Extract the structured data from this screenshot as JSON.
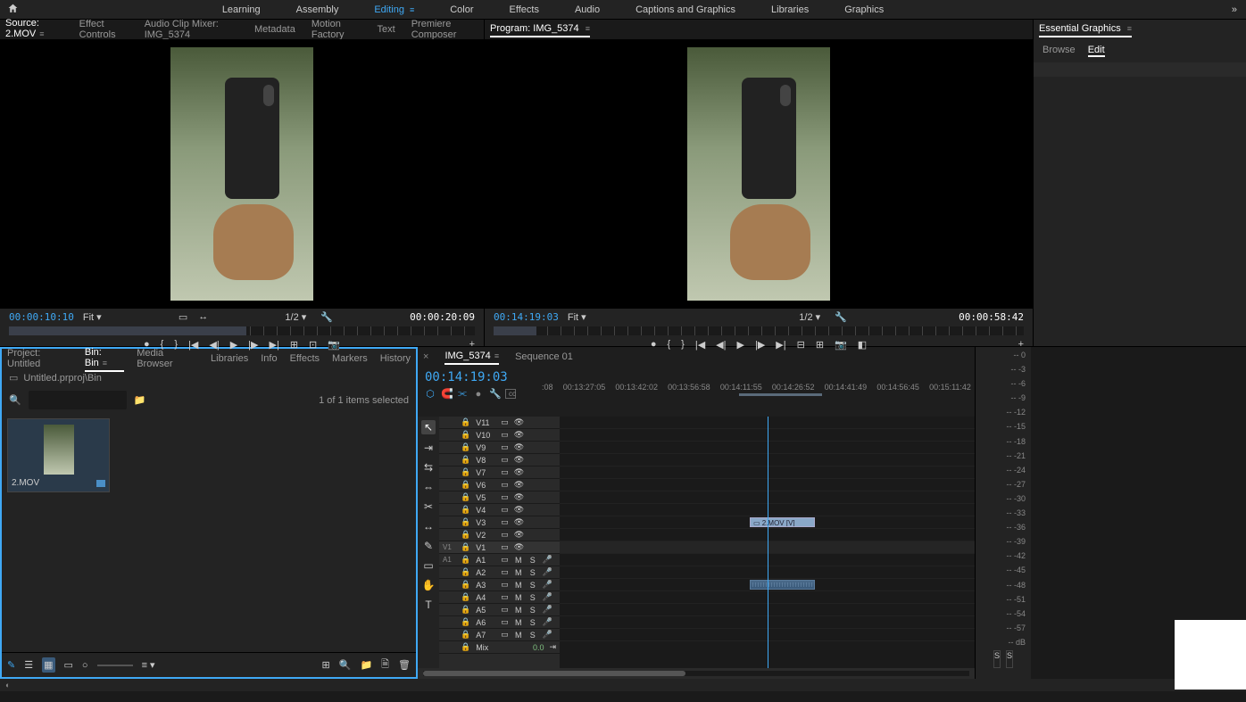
{
  "workspaces": {
    "items": [
      "Learning",
      "Assembly",
      "Editing",
      "Color",
      "Effects",
      "Audio",
      "Captions and Graphics",
      "Libraries",
      "Graphics"
    ],
    "active": "Editing"
  },
  "source": {
    "tabs": [
      "Source: 2.MOV",
      "Effect Controls",
      "Audio Clip Mixer: IMG_5374",
      "Metadata",
      "Motion Factory",
      "Text",
      "Premiere Composer"
    ],
    "active": "Source: 2.MOV",
    "timecode_in": "00:00:10:10",
    "timecode_dur": "00:00:20:09",
    "fit": "Fit",
    "zoom": "1/2"
  },
  "program": {
    "title": "Program: IMG_5374",
    "timecode": "00:14:19:03",
    "duration": "00:00:58:42",
    "fit": "Fit",
    "zoom": "1/2"
  },
  "essential": {
    "title": "Essential Graphics",
    "tabs": [
      "Browse",
      "Edit"
    ],
    "active": "Edit"
  },
  "project": {
    "tabs": [
      "Project: Untitled",
      "Bin: Bin",
      "Media Browser",
      "Libraries",
      "Info",
      "Effects",
      "Markers",
      "History"
    ],
    "active": "Bin: Bin",
    "breadcrumb": "Untitled.prproj\\Bin",
    "search_placeholder": "",
    "item_count": "1 of 1 items selected",
    "clip": {
      "name": "2.MOV"
    }
  },
  "timeline": {
    "tabs": [
      "IMG_5374",
      "Sequence 01"
    ],
    "active": "IMG_5374",
    "timecode": "00:14:19:03",
    "ruler": [
      ":08",
      "00:13:27:05",
      "00:13:42:02",
      "00:13:56:58",
      "00:14:11:55",
      "00:14:26:52",
      "00:14:41:49",
      "00:14:56:45",
      "00:15:11:42"
    ],
    "video_tracks": [
      "V11",
      "V10",
      "V9",
      "V8",
      "V7",
      "V6",
      "V5",
      "V4",
      "V3",
      "V2",
      "V1"
    ],
    "audio_tracks": [
      "A1",
      "A2",
      "A3",
      "A4",
      "A5",
      "A6",
      "A7"
    ],
    "mix": "Mix",
    "mix_val": "0.0",
    "patch_v": "V1",
    "patch_a": "A1",
    "clip_v3": "2.MOV [V]"
  },
  "audio_meter": {
    "scale": [
      "0",
      "-3",
      "-6",
      "-9",
      "-12",
      "-15",
      "-18",
      "-21",
      "-24",
      "-27",
      "-30",
      "-33",
      "-36",
      "-39",
      "-42",
      "-45",
      "-48",
      "-51",
      "-54",
      "-57",
      "dB"
    ],
    "labels": [
      "S",
      "S"
    ]
  },
  "toolbox": [
    "selection",
    "track-fwd",
    "ripple",
    "rolling",
    "razor",
    "slip",
    "pen",
    "rect",
    "hand",
    "type"
  ]
}
